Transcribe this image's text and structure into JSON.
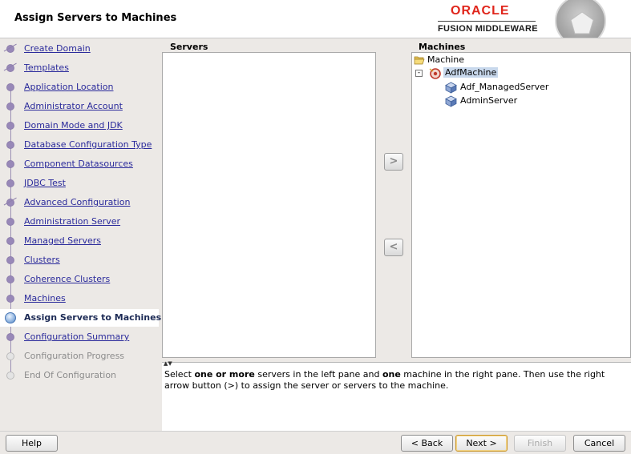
{
  "header": {
    "title": "Assign Servers to Machines",
    "brand_top": "ORACLE",
    "brand_bottom": "FUSION MIDDLEWARE"
  },
  "nav": {
    "items": [
      {
        "label": "Create Domain",
        "state": "complete"
      },
      {
        "label": "Templates",
        "state": "complete"
      },
      {
        "label": "Application Location",
        "state": "complete"
      },
      {
        "label": "Administrator Account",
        "state": "complete"
      },
      {
        "label": "Domain Mode and JDK",
        "state": "complete"
      },
      {
        "label": "Database Configuration Type",
        "state": "complete"
      },
      {
        "label": "Component Datasources",
        "state": "complete"
      },
      {
        "label": "JDBC Test",
        "state": "complete"
      },
      {
        "label": "Advanced Configuration",
        "state": "complete"
      },
      {
        "label": "Administration Server",
        "state": "complete"
      },
      {
        "label": "Managed Servers",
        "state": "complete"
      },
      {
        "label": "Clusters",
        "state": "complete"
      },
      {
        "label": "Coherence Clusters",
        "state": "complete"
      },
      {
        "label": "Machines",
        "state": "complete"
      },
      {
        "label": "Assign Servers to Machines",
        "state": "current"
      },
      {
        "label": "Configuration Summary",
        "state": "complete"
      },
      {
        "label": "Configuration Progress",
        "state": "future"
      },
      {
        "label": "End Of Configuration",
        "state": "future"
      }
    ]
  },
  "servers": {
    "label": "Servers",
    "items": []
  },
  "machines": {
    "label": "Machines",
    "root": "Machine",
    "machine": "AdfMachine",
    "servers": [
      "Adf_ManagedServer",
      "AdminServer"
    ]
  },
  "move_buttons": {
    "right": ">",
    "left": "<"
  },
  "help": {
    "part1": "Select ",
    "bold1": "one or more",
    "part2": " servers in the left pane and ",
    "bold2": "one",
    "part3": " machine in the right pane. Then use the right arrow button (>) to assign the server or servers to the machine."
  },
  "footer": {
    "help": "Help",
    "back": "< Back",
    "next": "Next >",
    "finish": "Finish",
    "cancel": "Cancel"
  },
  "colors": {
    "link": "#2a2a9b",
    "oracle_red": "#e0251b",
    "selection": "#c8d8ec"
  }
}
